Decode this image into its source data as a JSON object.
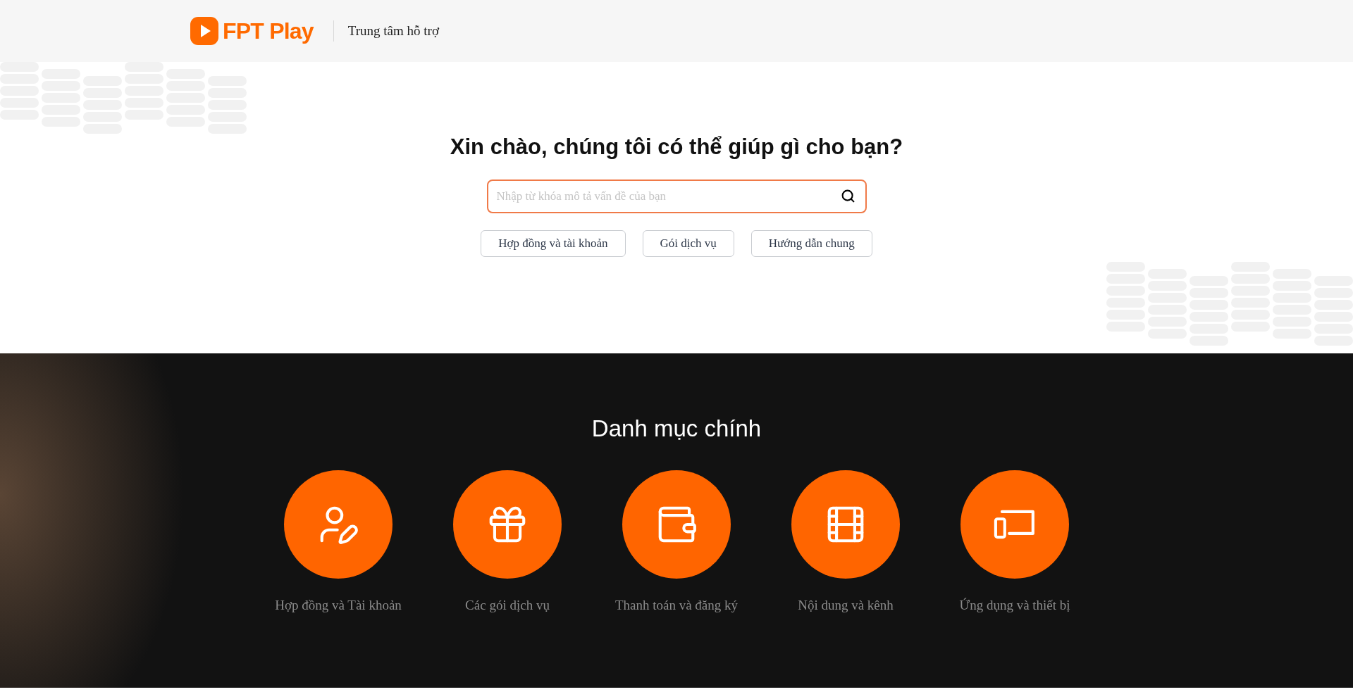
{
  "header": {
    "logo_text": "FPT Play",
    "title": "Trung tâm hỗ trợ"
  },
  "hero": {
    "heading": "Xin chào, chúng tôi có thể giúp gì cho bạn?",
    "search": {
      "placeholder": "Nhập từ khóa mô tả vấn đề của bạn"
    },
    "chips": [
      "Hợp đồng và tài khoản",
      "Gói dịch vụ",
      "Hướng dẫn chung"
    ]
  },
  "categories": {
    "heading": "Danh mục chính",
    "items": [
      {
        "label": "Hợp đồng và Tài khoản"
      },
      {
        "label": "Các gói dịch vụ"
      },
      {
        "label": "Thanh toán và đăng ký"
      },
      {
        "label": "Nội dung và kênh"
      },
      {
        "label": "Ứng dụng và thiết bị"
      }
    ]
  }
}
